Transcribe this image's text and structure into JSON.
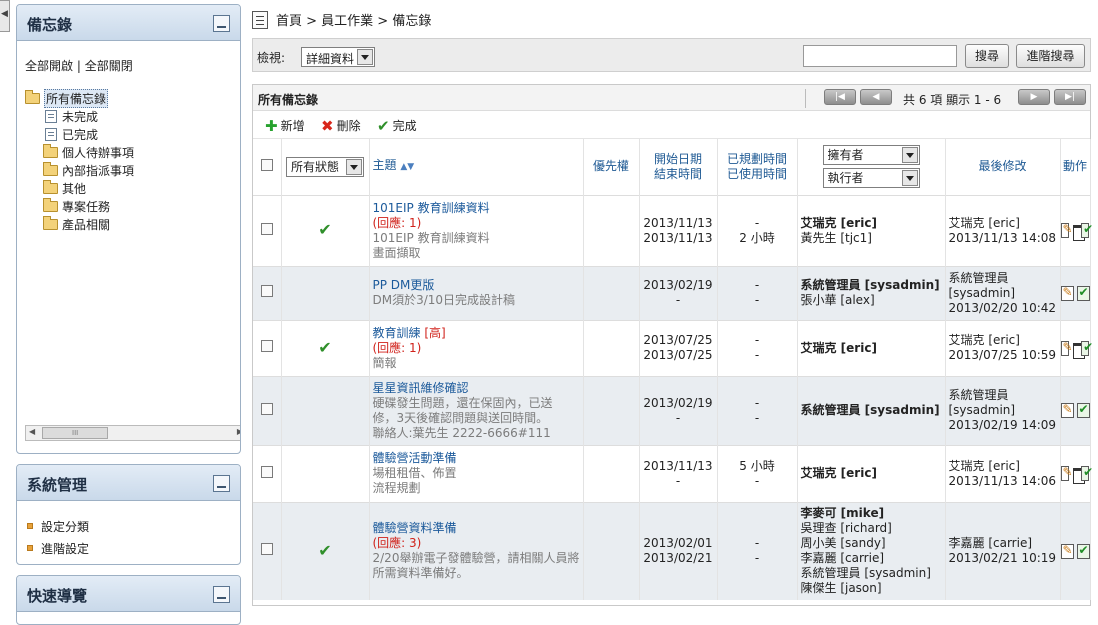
{
  "sidebar": {
    "memo_panel": {
      "title": "備忘錄",
      "expand_all": "全部開啟",
      "separator": " | ",
      "collapse_all": "全部關閉",
      "tree": {
        "root": "所有備忘錄",
        "children": [
          "未完成",
          "已完成",
          "個人待辦事項",
          "內部指派事項",
          "其他",
          "專案任務",
          "產品相關"
        ]
      }
    },
    "sys_panel": {
      "title": "系統管理",
      "items": [
        "設定分類",
        "進階設定"
      ]
    },
    "nav_panel": {
      "title": "快速導覽"
    }
  },
  "breadcrumb": "首頁 > 員工作業 > 備忘錄",
  "toolbar": {
    "view_label": "檢視:",
    "view_value": "詳細資料",
    "search_value": "",
    "search_button": "搜尋",
    "advanced_search_button": "進階搜尋"
  },
  "grid": {
    "title": "所有備忘錄",
    "pager_info": "共 6 項 顯示 1 - 6",
    "actions": {
      "add": "新增",
      "delete": "刪除",
      "complete": "完成"
    },
    "headers": {
      "status_filter": "所有狀態",
      "subject": "主題",
      "priority": "優先權",
      "start_date": "開始日期",
      "end_date": "結束時間",
      "planned_time": "已規劃時間",
      "used_time": "已使用時間",
      "owner_filter": "擁有者",
      "assignee_filter": "執行者",
      "last_modified": "最後修改",
      "action": "動作"
    },
    "rows": [
      {
        "done": true,
        "alt": false,
        "subject": "101EIP 教育訓練資料",
        "tag": "",
        "reply": "(回應: 1)",
        "desc": [
          "101EIP 教育訓練資料",
          "畫面擷取"
        ],
        "start": "2013/11/13",
        "end": "2013/11/13",
        "planned": "-",
        "used": "2 小時",
        "people_bold": "艾瑞克 [eric]",
        "people": [
          "黃先生 [tjc1]"
        ],
        "modified": [
          "艾瑞克 [eric]",
          "2013/11/13 14:08"
        ],
        "can_delete": true
      },
      {
        "done": false,
        "alt": true,
        "subject": "PP DM更版",
        "tag": "",
        "reply": "",
        "desc": [
          "DM須於3/10日完成設計稿"
        ],
        "start": "2013/02/19",
        "end": "-",
        "planned": "-",
        "used": "-",
        "people_bold": "系統管理員 [sysadmin]",
        "people": [
          "張小華 [alex]"
        ],
        "modified": [
          "系統管理員",
          "[sysadmin]",
          "2013/02/20 10:42"
        ],
        "can_delete": false
      },
      {
        "done": true,
        "alt": false,
        "subject": "教育訓練",
        "tag": "[高]",
        "reply": "(回應: 1)",
        "desc": [
          "簡報"
        ],
        "start": "2013/07/25",
        "end": "2013/07/25",
        "planned": "-",
        "used": "-",
        "people_bold": "艾瑞克 [eric]",
        "people": [],
        "modified": [
          "艾瑞克 [eric]",
          "2013/07/25 10:59"
        ],
        "can_delete": true
      },
      {
        "done": false,
        "alt": true,
        "subject": "星星資訊維修確認",
        "tag": "",
        "reply": "",
        "desc": [
          "硬碟發生問題，還在保固內，已送",
          "修，3天後確認問題與送回時間。",
          "聯絡人:葉先生 2222-6666#111"
        ],
        "start": "2013/02/19",
        "end": "-",
        "planned": "-",
        "used": "-",
        "people_bold": "系統管理員 [sysadmin]",
        "people": [],
        "modified": [
          "系統管理員",
          "[sysadmin]",
          "2013/02/19 14:09"
        ],
        "can_delete": false
      },
      {
        "done": false,
        "alt": false,
        "subject": "體驗營活動準備",
        "tag": "",
        "reply": "",
        "desc": [
          "場租租借、佈置",
          "流程規劃"
        ],
        "start": "2013/11/13",
        "end": "-",
        "planned": "5 小時",
        "used": "-",
        "people_bold": "艾瑞克 [eric]",
        "people": [],
        "modified": [
          "艾瑞克 [eric]",
          "2013/11/13 14:06"
        ],
        "can_delete": true
      },
      {
        "done": true,
        "alt": true,
        "subject": "體驗營資料準備",
        "tag": "",
        "reply": "(回應: 3)",
        "desc": [
          "2/20舉辦電子發體驗營，請相關人員將",
          "所需資料準備好。"
        ],
        "start": "2013/02/01",
        "end": "2013/02/21",
        "planned": "-",
        "used": "-",
        "people_bold": "李麥可 [mike]",
        "people": [
          "吳理查 [richard]",
          "周小美 [sandy]",
          "李嘉麗 [carrie]",
          "系統管理員 [sysadmin]",
          "陳傑生 [jason]"
        ],
        "modified": [
          "李嘉麗 [carrie]",
          "2013/02/21 10:19"
        ],
        "can_delete": false
      }
    ]
  }
}
